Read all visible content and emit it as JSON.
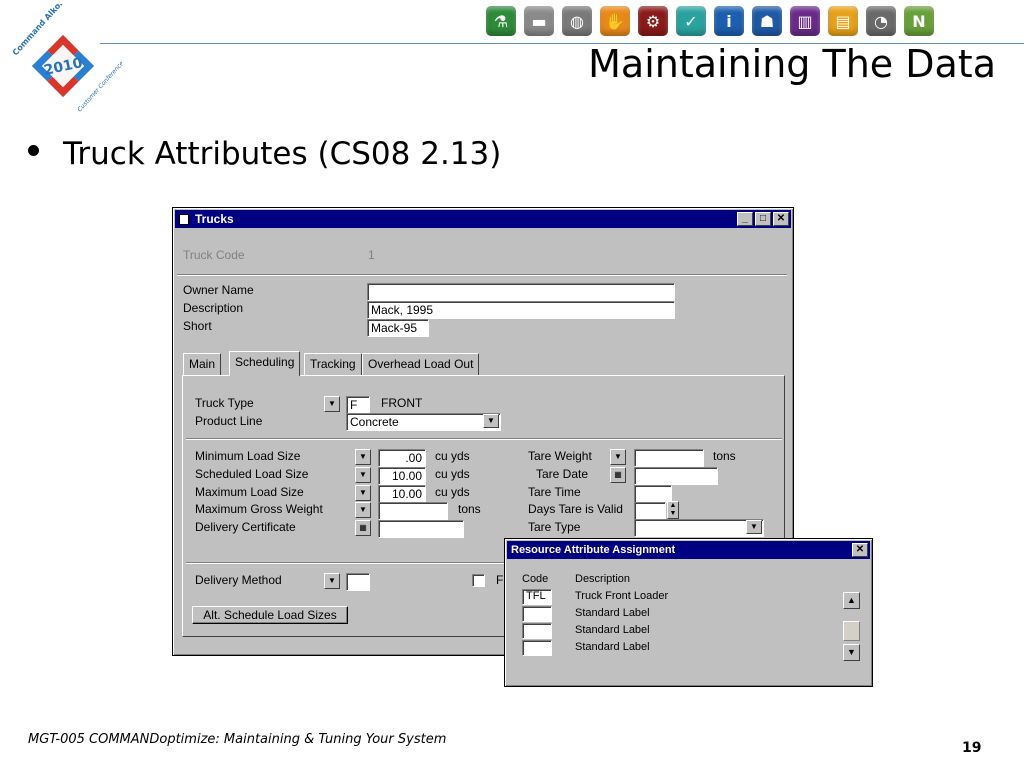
{
  "slide": {
    "title": "Maintaining The Data",
    "bullet": "Truck Attributes (CS08 2.13)",
    "footer": "MGT-005 COMMANDoptimize: Maintaining & Tuning Your System",
    "page_number": "19"
  },
  "logo": {
    "text_top": "Command Alkon",
    "year": "2010",
    "text_bottom": "Customer Conference"
  },
  "toolbar_icons": [
    {
      "icon": "flask-icon",
      "color": "#2e8b3a"
    },
    {
      "icon": "pavement-icon",
      "color": "#8a8a8a"
    },
    {
      "icon": "globe-icon",
      "color": "#7a7a7a"
    },
    {
      "icon": "hand-icon",
      "color": "#e88a1a"
    },
    {
      "icon": "gears-icon",
      "color": "#8b1a1a"
    },
    {
      "icon": "check-icon",
      "color": "#2aa3a0"
    },
    {
      "icon": "info-icon",
      "color": "#1c5fb0"
    },
    {
      "icon": "person-icon",
      "color": "#1f5aa6"
    },
    {
      "icon": "panels-icon",
      "color": "#6a2a8a"
    },
    {
      "icon": "document-icon",
      "color": "#e8a21a"
    },
    {
      "icon": "truck-icon",
      "color": "#6a6a6a"
    },
    {
      "icon": "n-icon",
      "color": "#6aa03a"
    }
  ],
  "trucks_window": {
    "title": "Trucks",
    "truck_code_label": "Truck Code",
    "truck_code_value": "1",
    "owner_name_label": "Owner Name",
    "owner_name_value": "",
    "description_label": "Description",
    "description_value": "Mack, 1995",
    "short_label": "Short",
    "short_value": "Mack-95",
    "tabs": [
      "Main",
      "Scheduling",
      "Tracking",
      "Overhead Load Out"
    ],
    "truck_type_label": "Truck Type",
    "truck_type_code": "F",
    "truck_type_desc": "FRONT",
    "product_line_label": "Product Line",
    "product_line_value": "Concrete",
    "min_load_label": "Minimum Load Size",
    "min_load_value": ".00",
    "min_load_unit": "cu yds",
    "sched_load_label": "Scheduled Load Size",
    "sched_load_value": "10.00",
    "sched_load_unit": "cu yds",
    "max_load_label": "Maximum Load Size",
    "max_load_value": "10.00",
    "max_load_unit": "cu yds",
    "max_gross_label": "Maximum Gross Weight",
    "max_gross_unit": "tons",
    "delivery_cert_label": "Delivery Certificate",
    "tare_weight_label": "Tare Weight",
    "tare_weight_unit": "tons",
    "tare_date_label": "Tare Date",
    "tare_time_label": "Tare Time",
    "days_tare_label": "Days Tare is Valid",
    "tare_type_label": "Tare Type",
    "delivery_method_label": "Delivery Method",
    "partial_label": "F",
    "alt_button": "Alt. Schedule Load Sizes"
  },
  "resource_dialog": {
    "title": "Resource Attribute Assignment",
    "col_code": "Code",
    "col_desc": "Description",
    "rows": [
      {
        "code": "TFL",
        "desc": "Truck Front Loader"
      },
      {
        "code": "",
        "desc": "Standard Label"
      },
      {
        "code": "",
        "desc": "Standard Label"
      },
      {
        "code": "",
        "desc": "Standard Label"
      }
    ]
  }
}
